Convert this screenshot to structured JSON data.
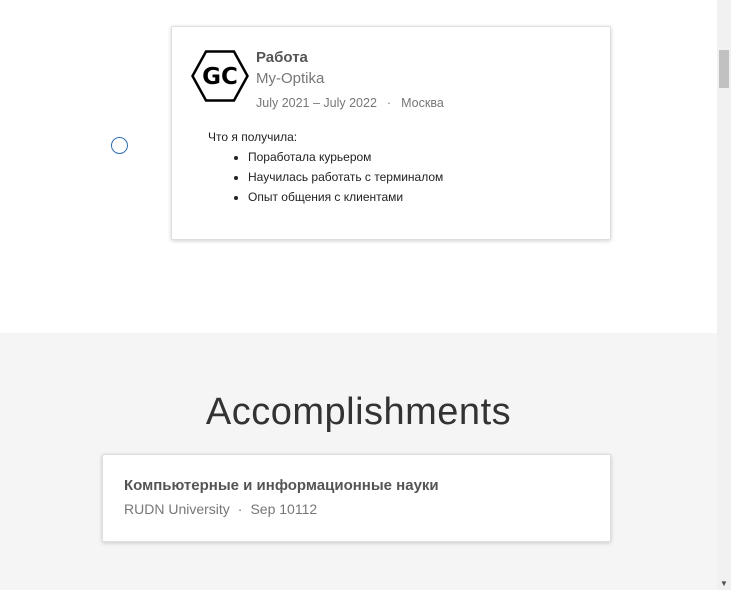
{
  "experience": {
    "title": "Работа",
    "company": "My-Optika",
    "dates": "July 2021 – July 2022",
    "separator": "·",
    "location": "Москва",
    "logo_text": "GC",
    "description_heading": "Что я получила:",
    "bullets": [
      "Поработала курьером",
      "Научилась работать с терминалом",
      "Опыт общения с клиентами"
    ]
  },
  "accomplishments": {
    "heading": "Accomplishments",
    "items": [
      {
        "name": "Компьютерные и информационные науки",
        "issuer": "RUDN University",
        "separator": "·",
        "date": "Sep 10112"
      }
    ]
  },
  "scrollbar": {
    "down_arrow": "▼"
  },
  "colors": {
    "timeline_dot": "#2f6fb3",
    "section_bg": "#f5f5f5"
  }
}
